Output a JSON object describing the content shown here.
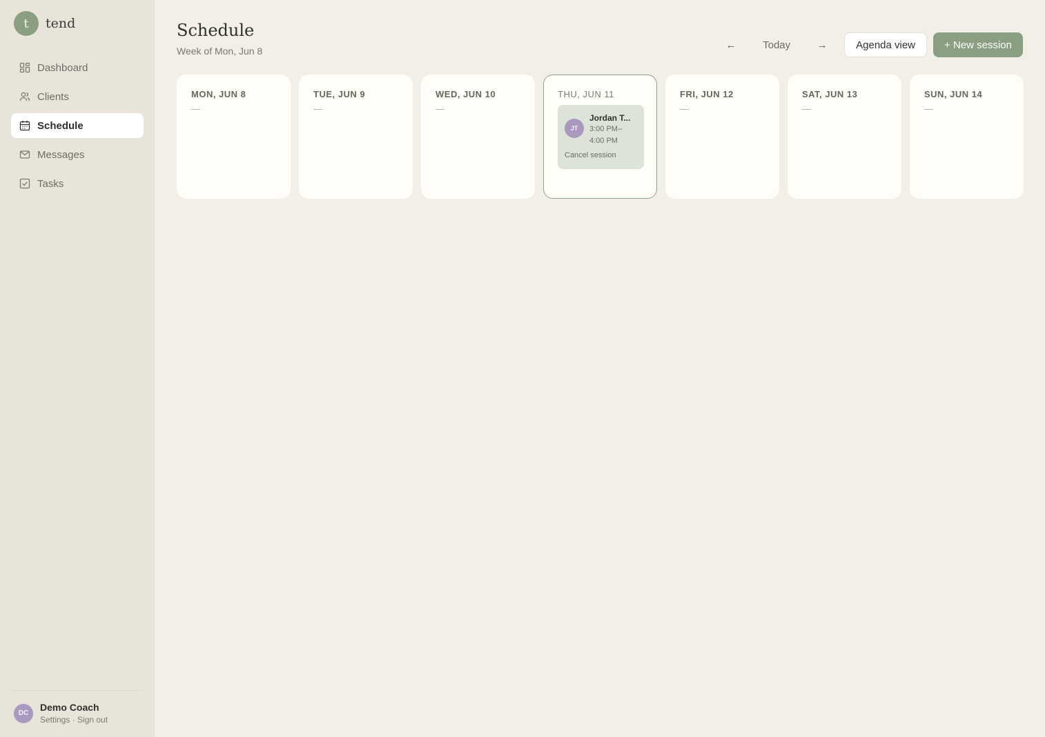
{
  "brand": {
    "logo_letter": "t",
    "name": "tend",
    "accent_color": "#8a9e82"
  },
  "sidebar": {
    "items": [
      {
        "label": "Dashboard",
        "icon": "dashboard-icon",
        "active": false
      },
      {
        "label": "Clients",
        "icon": "users-icon",
        "active": false
      },
      {
        "label": "Schedule",
        "icon": "calendar-icon",
        "active": true
      },
      {
        "label": "Messages",
        "icon": "mail-icon",
        "active": false
      },
      {
        "label": "Tasks",
        "icon": "checkbox-icon",
        "active": false
      }
    ]
  },
  "user": {
    "initials": "DC",
    "name": "Demo Coach",
    "settings_label": "Settings",
    "separator": " · ",
    "signout_label": "Sign out"
  },
  "header": {
    "title": "Schedule",
    "subtitle": "Week of Mon, Jun 8"
  },
  "toolbar": {
    "prev_label": "←",
    "today_label": "Today",
    "next_label": "→",
    "agenda_label": "Agenda view",
    "new_session_label": "+ New session"
  },
  "week": {
    "days": [
      {
        "label": "MON, JUN 8",
        "empty": "—"
      },
      {
        "label": "TUE, JUN 9",
        "empty": "—"
      },
      {
        "label": "WED, JUN 10",
        "empty": "—"
      },
      {
        "label": "THU, JUN 11",
        "session": {
          "initials": "JT",
          "name": "Jordan T...",
          "time_start": "3:00 PM–",
          "time_end": "4:00 PM",
          "cancel_label": "Cancel session"
        }
      },
      {
        "label": "FRI, JUN 12",
        "empty": "—"
      },
      {
        "label": "SAT, JUN 13",
        "empty": "—"
      },
      {
        "label": "SUN, JUN 14",
        "empty": "—"
      }
    ]
  }
}
